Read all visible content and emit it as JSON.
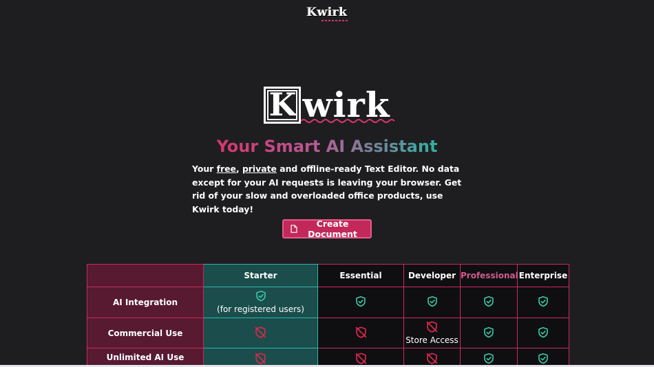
{
  "header": {
    "logo_text": "Kwirk"
  },
  "hero": {
    "logo_first_letter": "K",
    "logo_rest": "wirk",
    "tagline": "Your Smart AI Assistant",
    "intro": {
      "part1": "Your ",
      "free": "free",
      "sep": ", ",
      "private": "private",
      "part2": " and offline-ready Text Editor. No data except for your AI requests is leaving your browser. Get rid of your slow and overloaded office products, use Kwirk today!"
    },
    "cta_label": "Create Document"
  },
  "pricing": {
    "columns": [
      "Starter",
      "Essential",
      "Developer",
      "Professional",
      "Enterprise"
    ],
    "rows": [
      {
        "label": "AI Integration",
        "cells": [
          {
            "icon": "shield-check-icon",
            "note": "(for registered users)"
          },
          {
            "icon": "shield-check-icon",
            "note": ""
          },
          {
            "icon": "shield-check-icon",
            "note": ""
          },
          {
            "icon": "shield-check-icon",
            "note": ""
          },
          {
            "icon": "shield-check-icon",
            "note": ""
          }
        ]
      },
      {
        "label": "Commercial Use",
        "cells": [
          {
            "icon": "shield-off-icon",
            "note": ""
          },
          {
            "icon": "shield-off-icon",
            "note": ""
          },
          {
            "icon": "shield-off-icon",
            "note": "Store Access"
          },
          {
            "icon": "shield-check-icon",
            "note": ""
          },
          {
            "icon": "shield-check-icon",
            "note": ""
          }
        ]
      },
      {
        "label": "Unlimited AI Use",
        "cells": [
          {
            "icon": "shield-off-icon",
            "note": ""
          },
          {
            "icon": "shield-off-icon",
            "note": ""
          },
          {
            "icon": "shield-off-icon",
            "note": ""
          },
          {
            "icon": "shield-check-icon",
            "note": ""
          },
          {
            "icon": "shield-check-icon",
            "note": ""
          }
        ]
      }
    ]
  },
  "colors": {
    "background": "#1e1e21",
    "accent_pink": "#d6356b",
    "accent_teal": "#2fb7aa",
    "check_green": "#3cc9a6",
    "off_red": "#d9284e"
  }
}
